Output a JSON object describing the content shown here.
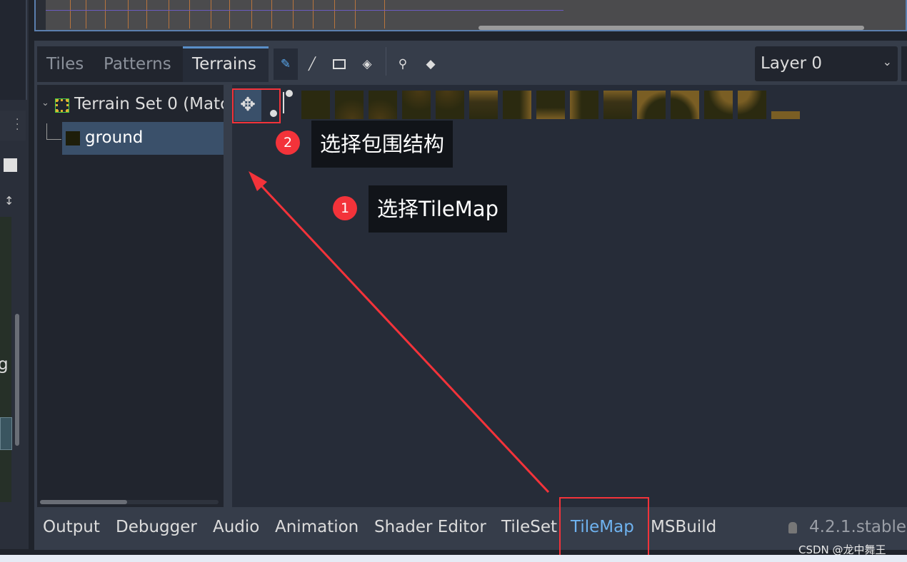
{
  "editor_tabs": {
    "tiles": "Tiles",
    "patterns": "Patterns",
    "terrains": "Terrains"
  },
  "tools": [
    "paint-icon",
    "line-icon",
    "rect-icon",
    "bucket-icon",
    "picker-icon",
    "eraser-icon"
  ],
  "layer_select": {
    "value": "Layer 0"
  },
  "tree": {
    "terrain_set": "Terrain Set 0 (Matc",
    "terrain": "ground"
  },
  "left_partial_text": "g",
  "bottom_tabs": [
    "Output",
    "Debugger",
    "Audio",
    "Animation",
    "Shader Editor",
    "TileSet",
    "TileMap",
    "MSBuild"
  ],
  "version": "4.2.1.stable.",
  "annotations": {
    "step1_num": "1",
    "step1": "选择TileMap",
    "step2_num": "2",
    "step2": "选择包围结构"
  },
  "watermark": "CSDN @龙中舞王",
  "colors": {
    "accent": "#5a8fc9",
    "annotation_red": "#f3333a",
    "active_bottom_tab": "#6fb3f0"
  }
}
